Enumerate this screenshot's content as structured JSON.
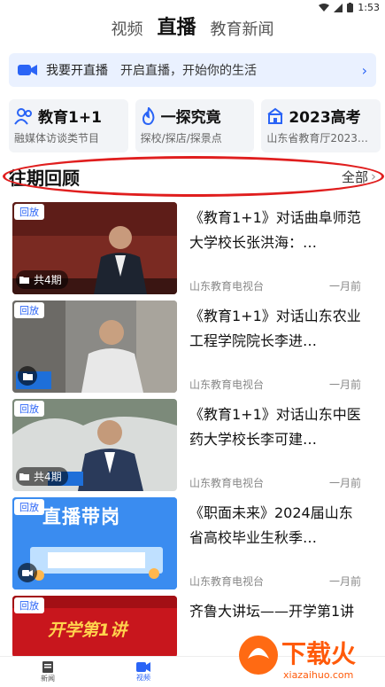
{
  "status_bar": {
    "time": "1:53"
  },
  "top_tabs": [
    {
      "label": "视频",
      "active": false
    },
    {
      "label": "直播",
      "active": true
    },
    {
      "label": "教育新闻",
      "active": false
    }
  ],
  "live_banner": {
    "label": "我要开直播",
    "subtitle": "开启直播，开始你的生活"
  },
  "cards": [
    {
      "title": "教育1+1",
      "subtitle": "融媒体访谈类节目",
      "icon": "people-icon"
    },
    {
      "title": "一探究竟",
      "subtitle": "探校/探店/探景点",
      "icon": "flame-icon"
    },
    {
      "title": "2023高考",
      "subtitle": "山东省教育厅2023…",
      "icon": "school-icon"
    }
  ],
  "section": {
    "title": "往期回顾",
    "all_label": "全部"
  },
  "items": [
    {
      "badge": "回放",
      "episodes": "共4期",
      "title": "《教育1+1》对话曲阜师范大学校长张洪海：…",
      "source": "山东教育电视台",
      "time": "一月前"
    },
    {
      "badge": "回放",
      "episodes": "",
      "title": "《教育1+1》对话山东农业工程学院院长李进…",
      "source": "山东教育电视台",
      "time": "一月前"
    },
    {
      "badge": "回放",
      "episodes": "共4期",
      "title": "《教育1+1》对话山东中医药大学校长李可建…",
      "source": "山东教育电视台",
      "time": "一月前"
    },
    {
      "badge": "回放",
      "episodes": "",
      "title": "《职面未来》2024届山东省高校毕业生秋季…",
      "source": "山东教育电视台",
      "time": "一月前"
    },
    {
      "badge": "回放",
      "episodes": "",
      "title": "齐鲁大讲坛——开学第1讲",
      "source": "",
      "time": ""
    }
  ],
  "thumb_texts": {
    "item4": "直播带岗",
    "item5": "开学第1讲"
  },
  "bottom_nav": [
    {
      "label": "新闻",
      "active": false
    },
    {
      "label": "视频",
      "active": true
    }
  ],
  "watermark": {
    "text": "下载火",
    "url": "xiazaihuo.com"
  },
  "colors": {
    "accent": "#2a64f6",
    "highlight": "#e01e1e"
  }
}
